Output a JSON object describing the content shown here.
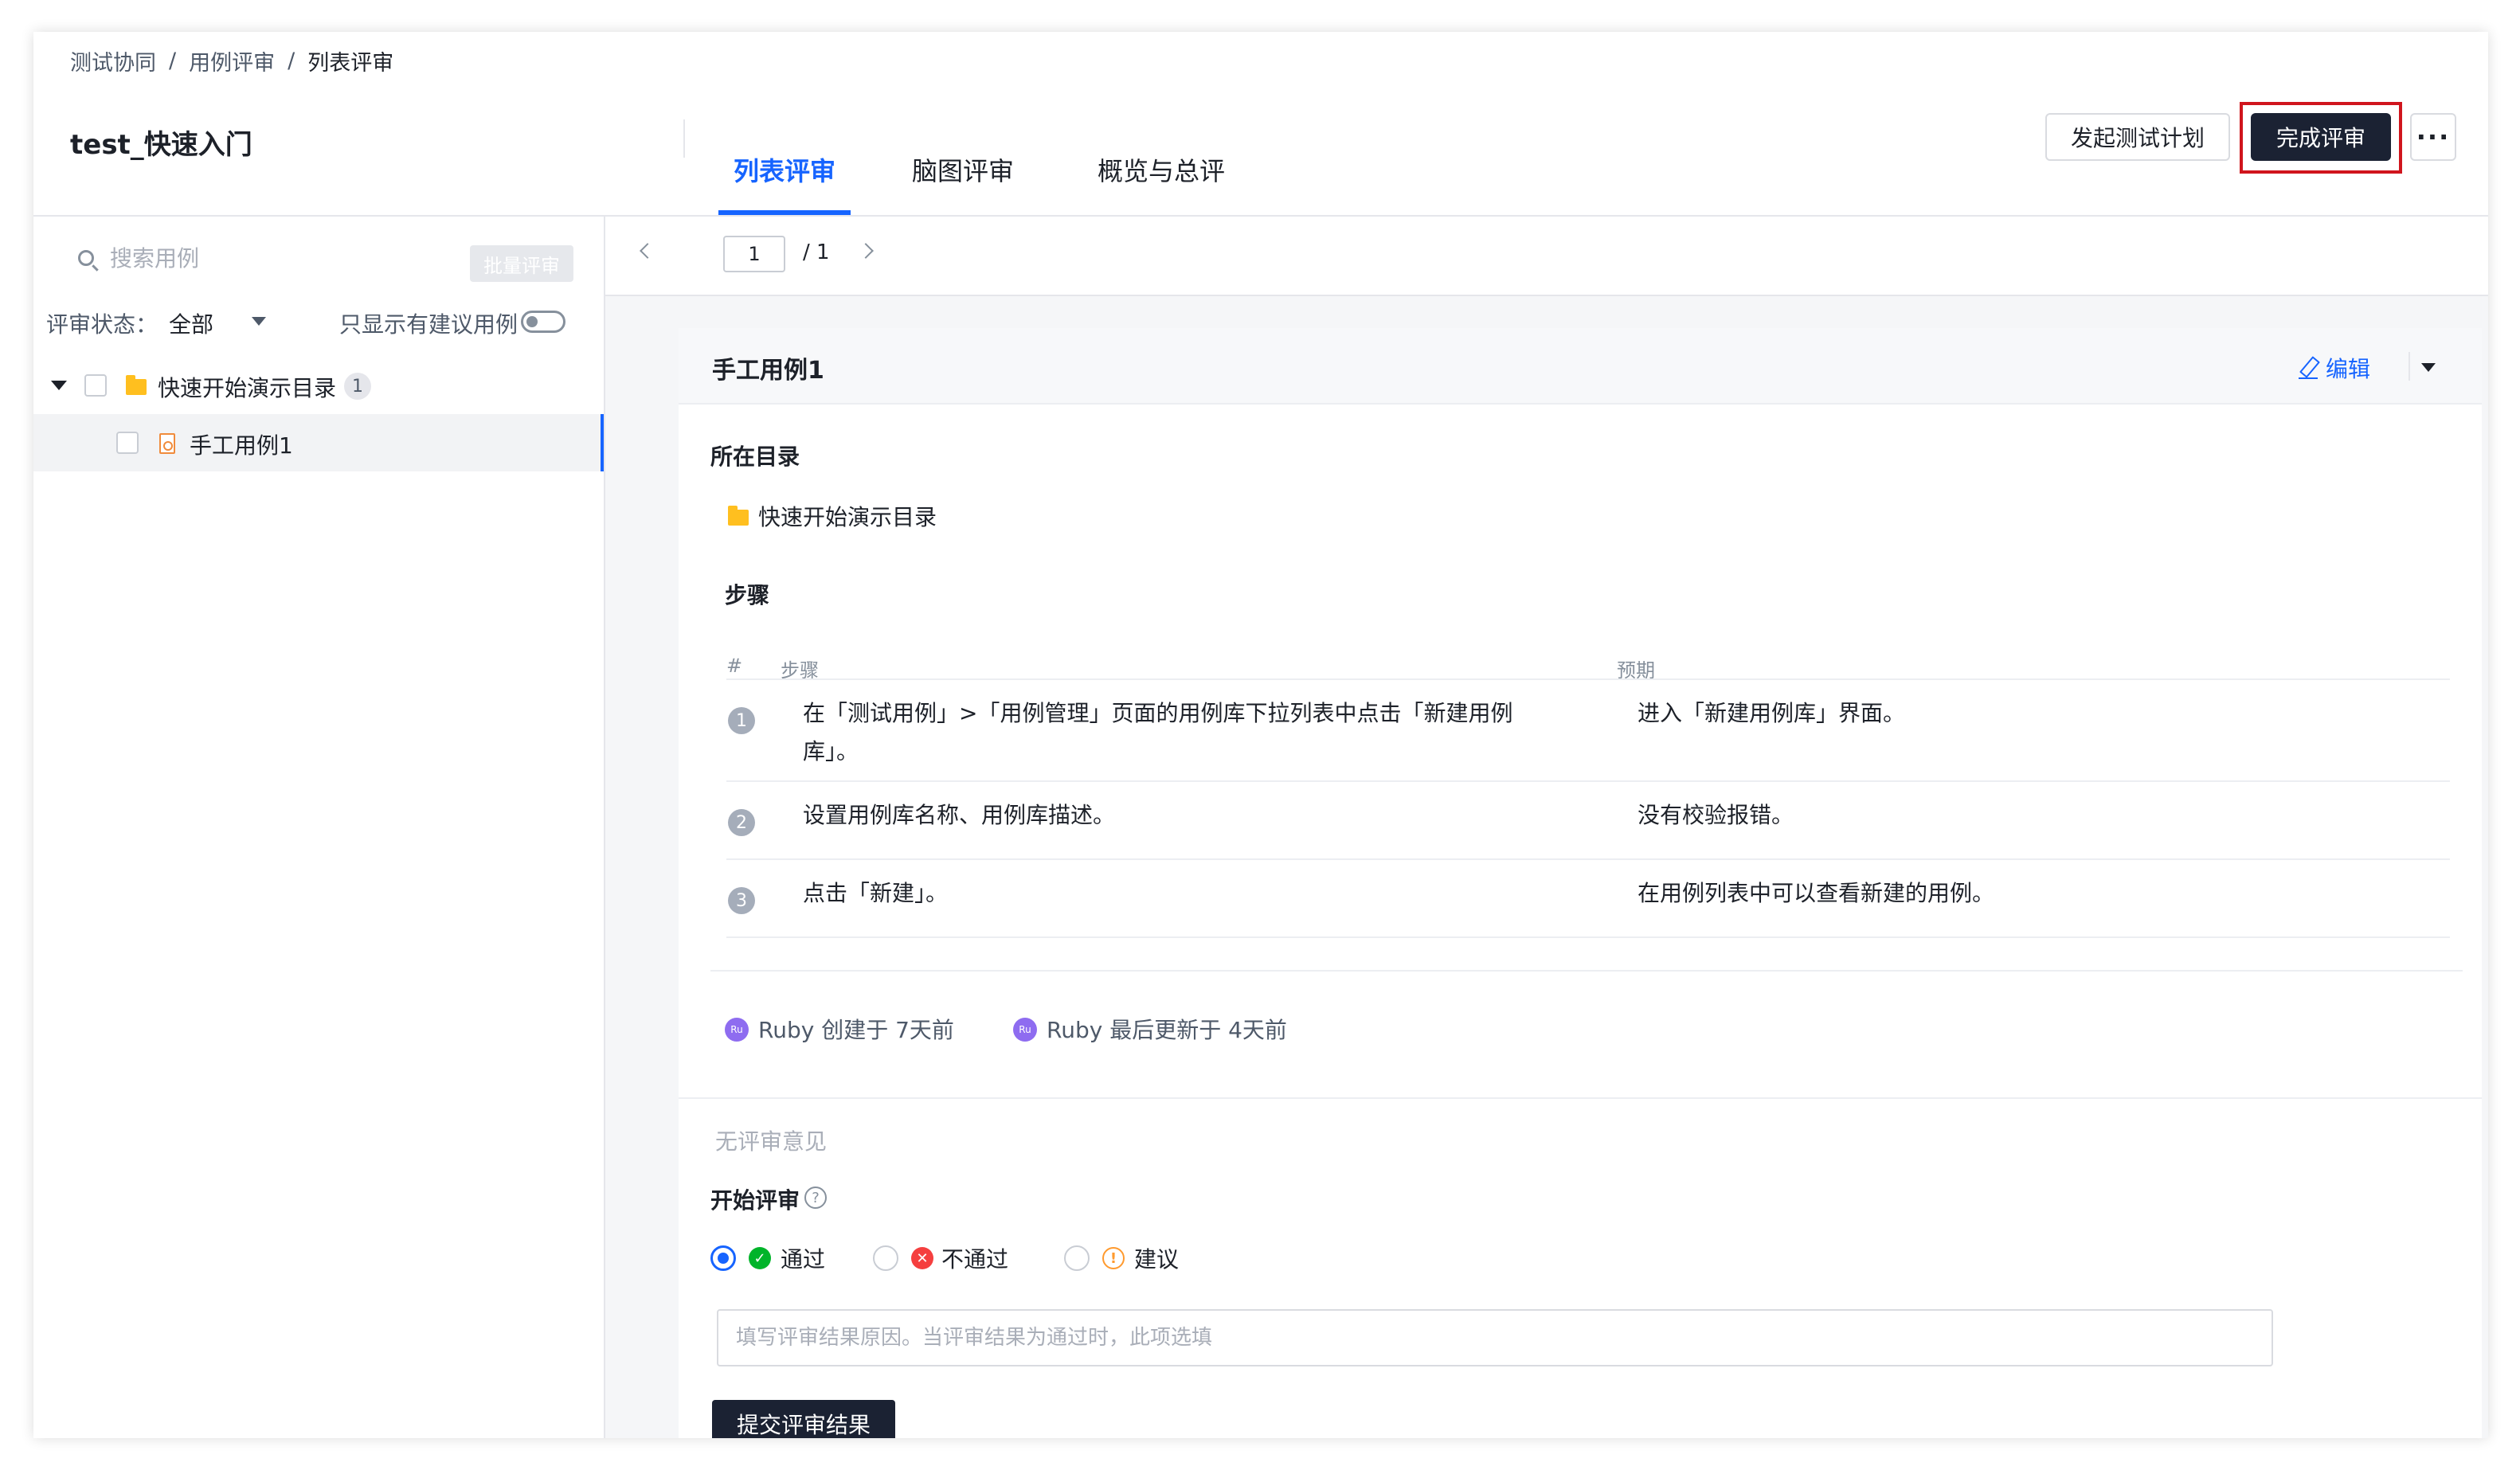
{
  "breadcrumb": [
    "测试协同",
    "用例评审",
    "列表评审"
  ],
  "breadcrumb_sep": "/",
  "page_title": "test_快速入门",
  "tabs": [
    {
      "label": "列表评审",
      "active": true
    },
    {
      "label": "脑图评审",
      "active": false
    },
    {
      "label": "概览与总评",
      "active": false
    }
  ],
  "actions": {
    "start_plan": "发起测试计划",
    "finish_review": "完成评审",
    "more": "···"
  },
  "sidebar": {
    "search_placeholder": "搜索用例",
    "batch_review": "批量评审",
    "filter_label": "评审状态：",
    "filter_value": "全部",
    "suggest_only_label": "只显示有建议用例",
    "suggest_only_on": false,
    "tree": [
      {
        "label": "快速开始演示目录",
        "type": "folder",
        "count": "1",
        "expanded": true
      },
      {
        "label": "手工用例1",
        "type": "case",
        "selected": true
      }
    ]
  },
  "pager": {
    "current": "1",
    "total": "/ 1"
  },
  "case": {
    "title": "手工用例1",
    "edit": "编辑",
    "directory_label": "所在目录",
    "directory": "快速开始演示目录",
    "steps_label": "步骤",
    "table_headers": {
      "num": "#",
      "step": "步骤",
      "expected": "预期"
    },
    "steps": [
      {
        "num": "1",
        "step_line1": "在「测试用例」>「用例管理」页面的用例库下拉列表中点击「新建用例",
        "step_line2": "库」。",
        "expected": "进入「新建用例库」界面。"
      },
      {
        "num": "2",
        "step": "设置用例库名称、用例库描述。",
        "expected": "没有校验报错。"
      },
      {
        "num": "3",
        "step": "点击「新建」。",
        "expected": "在用例列表中可以查看新建的用例。"
      }
    ],
    "meta": {
      "avatar_initials": "Ru",
      "created": "Ruby 创建于 7天前",
      "updated": "Ruby 最后更新于 4天前"
    }
  },
  "review": {
    "no_comment": "无评审意见",
    "start_label": "开始评审",
    "help_icon": "?",
    "options": [
      {
        "label": "通过",
        "icon": "check-circle",
        "color": "#00b42a",
        "checked": true
      },
      {
        "label": "不通过",
        "icon": "close-circle",
        "color": "#f53f3f",
        "checked": false
      },
      {
        "label": "建议",
        "icon": "exclamation-circle",
        "color": "#ff9a2e",
        "checked": false
      }
    ],
    "reason_placeholder": "填写评审结果原因。当评审结果为通过时，此项选填",
    "submit": "提交评审结果"
  },
  "colors": {
    "accent": "#1664ff",
    "dark_button": "#1b2233",
    "highlight_border": "#d0151d"
  }
}
